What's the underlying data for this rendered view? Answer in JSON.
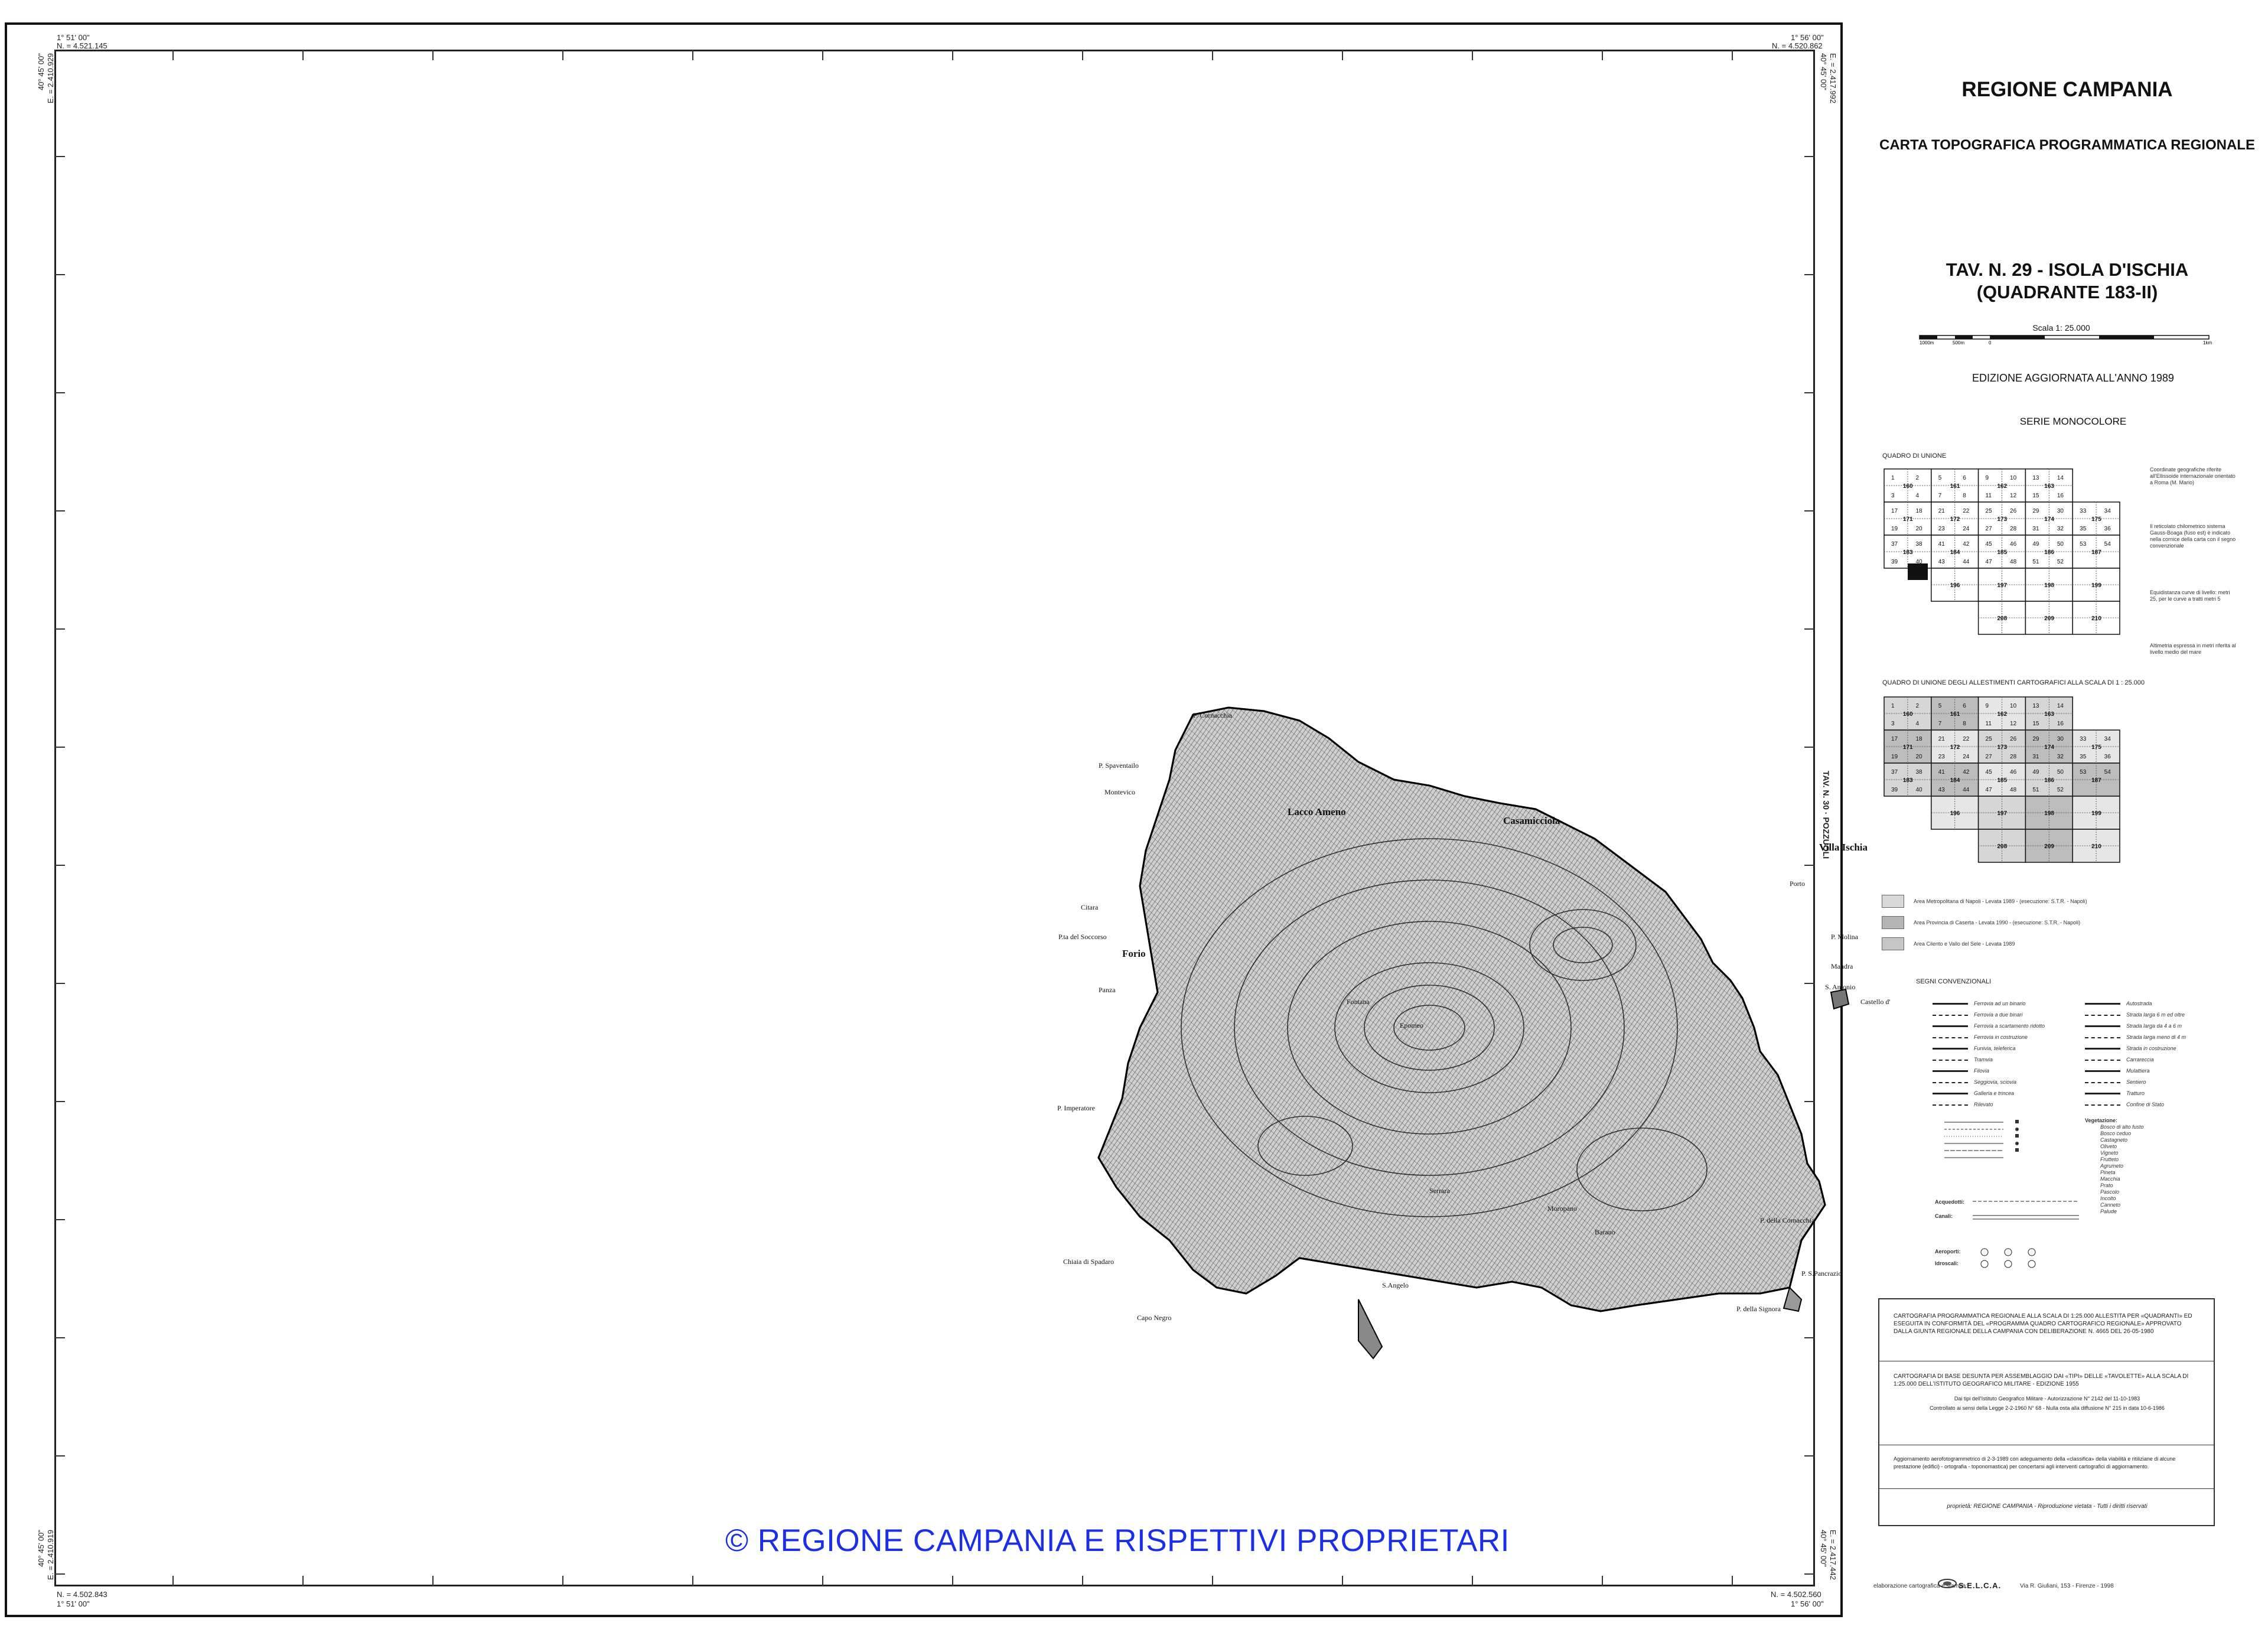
{
  "frame": {
    "top_left_deg": "1° 51' 00\"",
    "top_left_north": "N. = 4.521.145",
    "top_left_east": "E. = 2.410.929",
    "top_left_lat": "40° 45' 00\"",
    "top_right_deg": "1° 56' 00\"",
    "top_right_north": "N. = 4.520.862",
    "top_right_east": "E. = 2.417.992",
    "top_right_lat": "40° 45' 00\"",
    "bottom_left_deg": "1° 51' 00\"",
    "bottom_left_north": "N. = 4.502.843",
    "bottom_left_east": "E. = 2.410.919",
    "bottom_left_lat": "40° 45' 00\"",
    "bottom_right_deg": "1° 56' 00\"",
    "bottom_right_north": "N. = 4.502.560",
    "bottom_right_east": "E. = 2.417.442",
    "bottom_right_lat": "40° 45' 00\"",
    "adjacent_sheet": "TAV. N. 30 · POZZUOLI"
  },
  "map": {
    "places": [
      {
        "name": "Lacco Ameno",
        "big": true
      },
      {
        "name": "Casamicciola",
        "big": true
      },
      {
        "name": "Forio",
        "big": true
      },
      {
        "name": "S.Angelo",
        "big": false
      },
      {
        "name": "Villa Ischia",
        "big": true
      },
      {
        "name": "P. Cornacchia",
        "big": false
      },
      {
        "name": "P. Spaventailo",
        "big": false
      },
      {
        "name": "Montevico",
        "big": false
      },
      {
        "name": "P.ta del Soccorso",
        "big": false
      },
      {
        "name": "P. Imperatore",
        "big": false
      },
      {
        "name": "Chiaia di Spadaro",
        "big": false
      },
      {
        "name": "Capo Negro",
        "big": false
      },
      {
        "name": "P. della Signora",
        "big": false
      },
      {
        "name": "P. S.Pancrazio",
        "big": false
      },
      {
        "name": "P. della Cornacchia",
        "big": false
      },
      {
        "name": "P. Molina",
        "big": false
      },
      {
        "name": "Mandra",
        "big": false
      },
      {
        "name": "S. Antonio",
        "big": false
      },
      {
        "name": "Castello d'Ischia",
        "big": false
      },
      {
        "name": "Porto",
        "big": false
      },
      {
        "name": "Epomeo",
        "big": false
      },
      {
        "name": "Fontana",
        "big": false
      },
      {
        "name": "Serrara",
        "big": false
      },
      {
        "name": "Barano",
        "big": false
      },
      {
        "name": "Moropano",
        "big": false
      },
      {
        "name": "Panza",
        "big": false
      },
      {
        "name": "Citara",
        "big": false
      }
    ]
  },
  "watermark": "© REGIONE CAMPANIA E RISPETTIVI PROPRIETARI",
  "legend": {
    "region": "REGIONE CAMPANIA",
    "series_title": "CARTA TOPOGRAFICA PROGRAMMATICA REGIONALE",
    "tav_line1": "TAV. N. 29 - ISOLA D'ISCHIA",
    "tav_line2": "(QUADRANTE 183-II)",
    "scale": "Scala  1: 25.000",
    "scale_ticks": [
      "1000m",
      "500m",
      "0",
      "1km"
    ],
    "edition": "EDIZIONE  AGGIORNATA  ALL'ANNO  1989",
    "series": "SERIE MONOCOLORE",
    "quadro_unione": "QUADRO DI UNIONE",
    "quadro_allestimenti": "QUADRO DI UNIONE DEGLI ALLESTIMENTI CARTOGRAFICI ALLA SCALA DI 1 : 25.000",
    "notes": [
      "Coordinate geografiche riferite all'Ellissoide internazionale orientato a Roma (M. Mario)",
      "Il reticolato chilometrico sistema Gauss-Boaga (fuso est) è indicato nella cornice della carta con il segno convenzionale",
      "Equidistanza curve di livello: metri 25, per le curve a tratti metri 5",
      "Altimetria espressa in metri riferita al livello medio del mare"
    ],
    "grid_sheets": [
      "160",
      "161",
      "162",
      "163",
      "171",
      "172",
      "173",
      "174",
      "175",
      "183",
      "184",
      "185",
      "186",
      "187",
      "196",
      "197",
      "198",
      "199",
      "208",
      "209",
      "210"
    ],
    "grid_cells": [
      "1",
      "2",
      "3",
      "4",
      "5",
      "6",
      "7",
      "8",
      "9",
      "10",
      "11",
      "12",
      "13",
      "14",
      "15",
      "16",
      "17",
      "18",
      "19",
      "20",
      "21",
      "22",
      "23",
      "24",
      "25",
      "26",
      "27",
      "28",
      "29",
      "30",
      "31",
      "32",
      "33",
      "34",
      "35",
      "36",
      "37",
      "38",
      "39",
      "40",
      "41",
      "42",
      "43",
      "44",
      "45",
      "46",
      "47",
      "48",
      "49",
      "50",
      "51",
      "52",
      "53",
      "54"
    ],
    "key_items": [
      "Area Metropolitana di Napoli  -  Levata 1989  -  (esecuzione: S.T.R. - Napoli)",
      "Area Provincia di Caserta  -  Levata 1990  -  (esecuzione: S.T.R. - Napoli)",
      "Area Cilento e Vallo del Sele  -  Levata 1989"
    ],
    "segni": "SEGNI CONVENZIONALI",
    "segni_left": [
      "Ferrovia ad un binario",
      "Ferrovia a due binari",
      "Ferrovia a scartamento ridotto",
      "Ferrovia in costruzione",
      "Funivia, teleferica",
      "Tramvia",
      "Filovia",
      "Seggiovia, sciovia",
      "Galleria e trincea",
      "Rilevato"
    ],
    "segni_right": [
      "Autostrada",
      "Strada larga 6 m ed oltre",
      "Strada larga da 4 a 6 m",
      "Strada larga meno di 4 m",
      "Strada in costruzione",
      "Carrareccia",
      "Mulattiera",
      "Sentiero",
      "Tratturo",
      "Confine di Stato"
    ],
    "vegetation_title": "Vegetazione:",
    "vegetation": [
      "Bosco di alto fusto",
      "Bosco ceduo",
      "Castagneto",
      "Oliveto",
      "Vigneto",
      "Frutteto",
      "Agrumeto",
      "Pineta",
      "Macchia",
      "Prato",
      "Pascolo",
      "Incolto",
      "Canneto",
      "Palude"
    ],
    "acquedotti": "Acquedotti:",
    "canali": "Canali:",
    "aeroporti": "Aeroporti:",
    "idroscali": "Idroscali:",
    "info": [
      "CARTOGRAFIA PROGRAMMATICA REGIONALE ALLA SCALA DI 1:25.000 ALLESTITA PER «QUADRANTI» ED ESEGUITA IN CONFORMITÀ DEL «PROGRAMMA QUADRO CARTOGRAFICO REGIONALE» APPROVATO DALLA GIUNTA REGIONALE DELLA CAMPANIA CON DELIBERAZIONE N. 4665 DEL 26-05-1980",
      "CARTOGRAFIA DI BASE DESUNTA PER ASSEMBLAGGIO DAI «TIPI» DELLE «TAVOLETTE» ALLA SCALA DI 1:25.000 DELL'ISTITUTO GEOGRAFICO MILITARE - EDIZIONE 1955",
      "Dai tipi dell'Istituto Geografico Militare - Autorizzazione N° 2142 del 11-10-1983",
      "Controllato ai sensi della Legge 2-2-1960 N° 68 - Nulla osta alla diffusione N° 215 in data 10-6-1986",
      "Aggiornamento aerofotogrammetrico di 2-3-1989 con adeguamento della «classifica» della viabilità e ritiliziane di alcune prestazione (edifici) - ortografia - toponomastica) per concertarsi agli interventi cartografici di aggiornamento.",
      "proprietà: REGIONE CAMPANIA - Riproduzione vietata - Tutti i diritti riservati"
    ],
    "credits": "elaborazione cartografica e stampa:",
    "selca": "S.E.L.C.A.",
    "selca_addr": "Via R. Giuliani, 153 - Firenze - 1998"
  }
}
